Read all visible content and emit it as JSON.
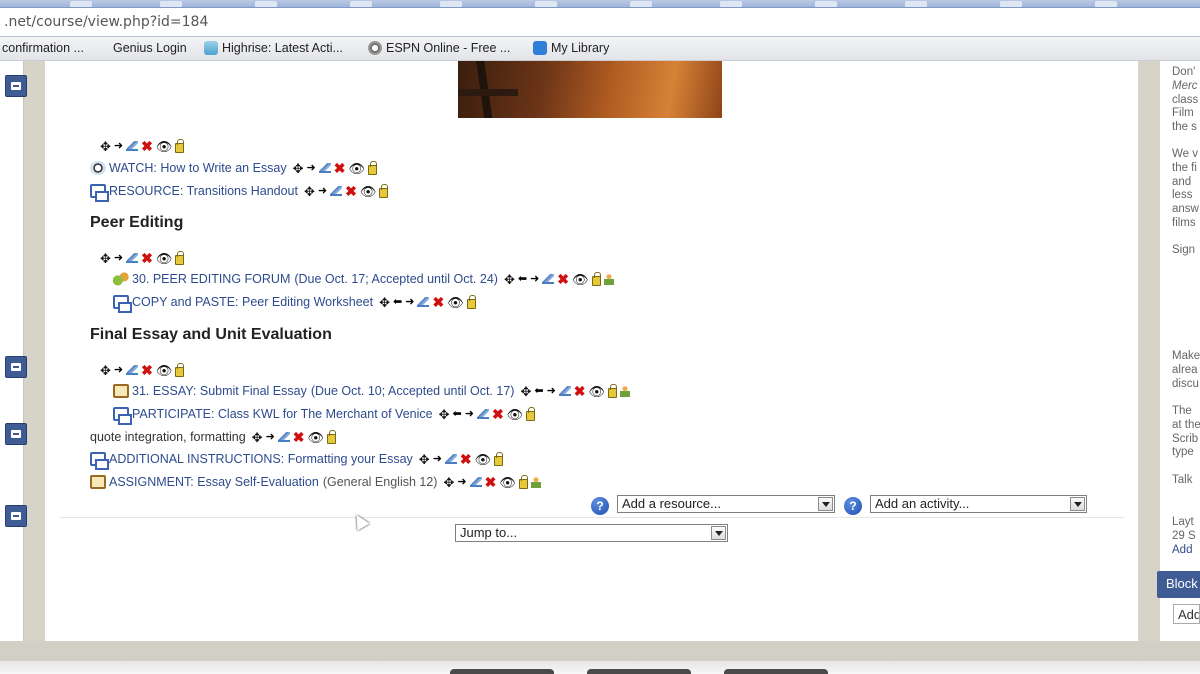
{
  "browser": {
    "url": ".net/course/view.php?id=184",
    "bookmarks": [
      {
        "label": "confirmation ..."
      },
      {
        "label": "Genius Login"
      },
      {
        "label": "Highrise: Latest Acti..."
      },
      {
        "label": "ESPN Online - Free ..."
      },
      {
        "label": "My Library"
      }
    ]
  },
  "course": {
    "topic_rows": [
      {
        "prefix": "WATCH:",
        "title": "How to Write an Essay"
      },
      {
        "prefix": "RESOURCE:",
        "title": "Transitions Handout"
      }
    ],
    "peer_editing": {
      "heading": "Peer Editing",
      "items": [
        {
          "title": "30. PEER EDITING FORUM",
          "note": "(Due Oct. 17; Accepted until Oct. 24)"
        },
        {
          "prefix": "COPY and PASTE:",
          "title": "Peer Editing Worksheet"
        }
      ]
    },
    "final_essay": {
      "heading": "Final Essay and Unit Evaluation",
      "items": [
        {
          "title": "31. ESSAY: Submit Final Essay",
          "note": "(Due Oct. 10; Accepted until Oct. 17)"
        },
        {
          "prefix": "PARTICIPATE:",
          "title": "Class KWL for The Merchant of Venice"
        }
      ],
      "label": "quote integration, formatting",
      "more": [
        {
          "prefix": "ADDITIONAL INSTRUCTIONS:",
          "title": "Formatting your Essay"
        },
        {
          "prefix": "ASSIGNMENT:",
          "title": "Essay Self-Evaluation",
          "note": "(General English 12)"
        }
      ]
    },
    "add_resource": "Add a resource...",
    "add_activity": "Add an activity...",
    "jump_to": "Jump to...",
    "help_glyph": "?"
  },
  "sidebar": {
    "para1": [
      "Don'",
      "Merc",
      "class",
      "Film",
      "the s"
    ],
    "para2": [
      "We v",
      "the fi",
      "and",
      "less",
      "answ",
      "films"
    ],
    "para3": [
      "Sign"
    ],
    "para4": [
      "Make",
      "alrea",
      "discu"
    ],
    "para5": [
      "The",
      "at the",
      "Scrib",
      "type"
    ],
    "para6": [
      "Talk"
    ],
    "para7": [
      "Layt",
      "29 S",
      "Add"
    ],
    "block_tab": "Block",
    "input_value": "Add"
  },
  "icons": {
    "move": "✥",
    "right": "➜",
    "left": "⬅",
    "delete": "✖",
    "eye": "👁"
  },
  "colors": {
    "link": "#2d4b8e",
    "accent": "#3f5c94",
    "delete": "#d01010"
  }
}
